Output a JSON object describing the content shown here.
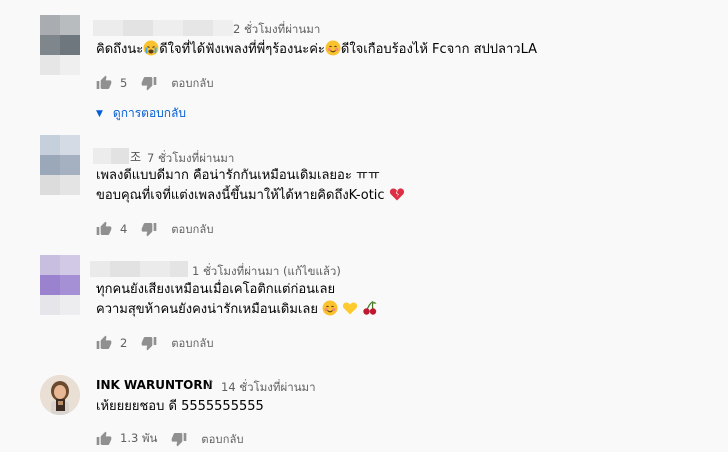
{
  "comments": [
    {
      "timestamp": "2 ชั่วโมงที่ผ่านมา",
      "lines": [
        "คิดถึงนะ",
        "ดีใจที่ได้ฟังเพลงที่พี่ๆร้องนะค่ะ",
        "ดีใจเกือบร้องไห้ Fcจาก สปปลาวLA"
      ],
      "likes": "5",
      "reply_label": "ตอบกลับ",
      "view_replies": "ดูการตอบกลับ"
    },
    {
      "name_suffix": "조",
      "timestamp": "7 ชั่วโมงที่ผ่านมา",
      "lines": [
        "เพลงดีแบบดีมาก คือน่ารักกันเหมือนเดิมเลยอะ ㅠㅠ",
        "ขอบคุณที่เจที่แต่งเพลงนี้ขึ้นมาให้ได้หายคิดถึงK-otic"
      ],
      "likes": "4",
      "reply_label": "ตอบกลับ"
    },
    {
      "timestamp": "1 ชั่วโมงที่ผ่านมา (แก้ไขแล้ว)",
      "lines": [
        "ทุกคนยังเสียงเหมือนเมื่อเคโอติกแต่ก่อนเลย",
        "ความสุขห้าคนยังคงน่ารักเหมือนเดิมเลย"
      ],
      "likes": "2",
      "reply_label": "ตอบกลับ"
    },
    {
      "author": "INK WARUNTORN",
      "timestamp": "14 ชั่วโมงที่ผ่านมา",
      "lines": [
        "เห้ยยยยชอบ ดี 5555555555"
      ],
      "likes": "1.3 พัน",
      "reply_label": "ตอบกลับ"
    }
  ],
  "colors": {
    "link": "#065fd4",
    "meta": "#606060",
    "text": "#030303",
    "background": "#f9f9f9"
  },
  "icons": [
    "thumb-up-icon",
    "thumb-down-icon",
    "caret-down-icon",
    "music-note-icon",
    "crying-face-emoji",
    "smiling-face-emoji",
    "broken-heart-emoji",
    "yellow-heart-emoji",
    "cherries-emoji"
  ]
}
